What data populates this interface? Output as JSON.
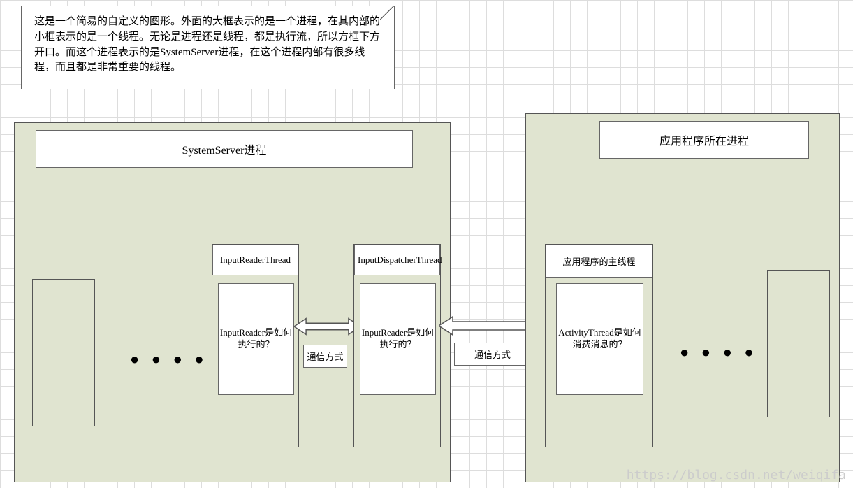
{
  "note": {
    "text": "这是一个简易的自定义的图形。外面的大框表示的是一个进程，在其内部的小框表示的是一个线程。无论是进程还是线程，都是执行流，所以方框下方开口。而这个进程表示的是SystemServer进程，在这个进程内部有很多线程，而且都是非常重要的线程。"
  },
  "process1": {
    "title": "SystemServer进程",
    "dots_left": "● ● ● ● ●",
    "thread1": {
      "label": "InputReaderThread",
      "inner": "InputReader是如何执行的？"
    },
    "thread2": {
      "label": "InputDispatcherThread",
      "inner": "InputReader是如何执行的？"
    },
    "comm1": "通信方式"
  },
  "comm_mid": "通信方式",
  "process2": {
    "title": "应用程序所在进程",
    "thread1": {
      "label": "应用程序的主线程",
      "inner": "ActivityThread是如何消费消息的？"
    },
    "dots_right": "● ● ● ● ● ●"
  },
  "watermark": "https://blog.csdn.net/weiqifa"
}
